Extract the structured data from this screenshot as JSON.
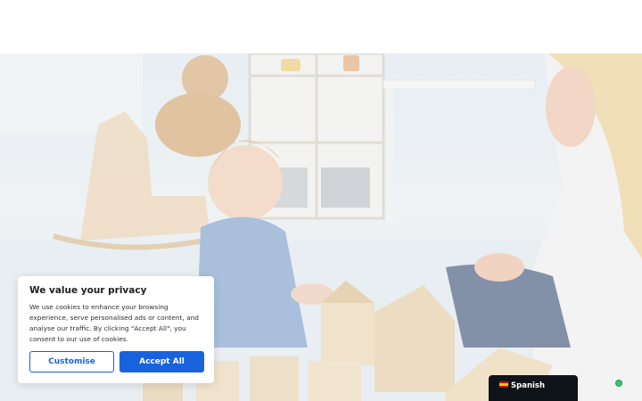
{
  "hero": {
    "image_description_icon": "baby-playing-with-wooden-blocks-image"
  },
  "cookie_banner": {
    "title": "We value your privacy",
    "body": "We use cookies to enhance your browsing experience, serve personalised ads or content, and analyse our traffic. By clicking \"Accept All\", you consent to our use of cookies.",
    "customise_label": "Customise",
    "accept_label": "Accept All"
  },
  "language_switcher": {
    "flag_icon": "spain-flag-icon",
    "label": "Spanish"
  },
  "colors": {
    "accent": "#1863dc",
    "language_bar": "#0f1419"
  }
}
